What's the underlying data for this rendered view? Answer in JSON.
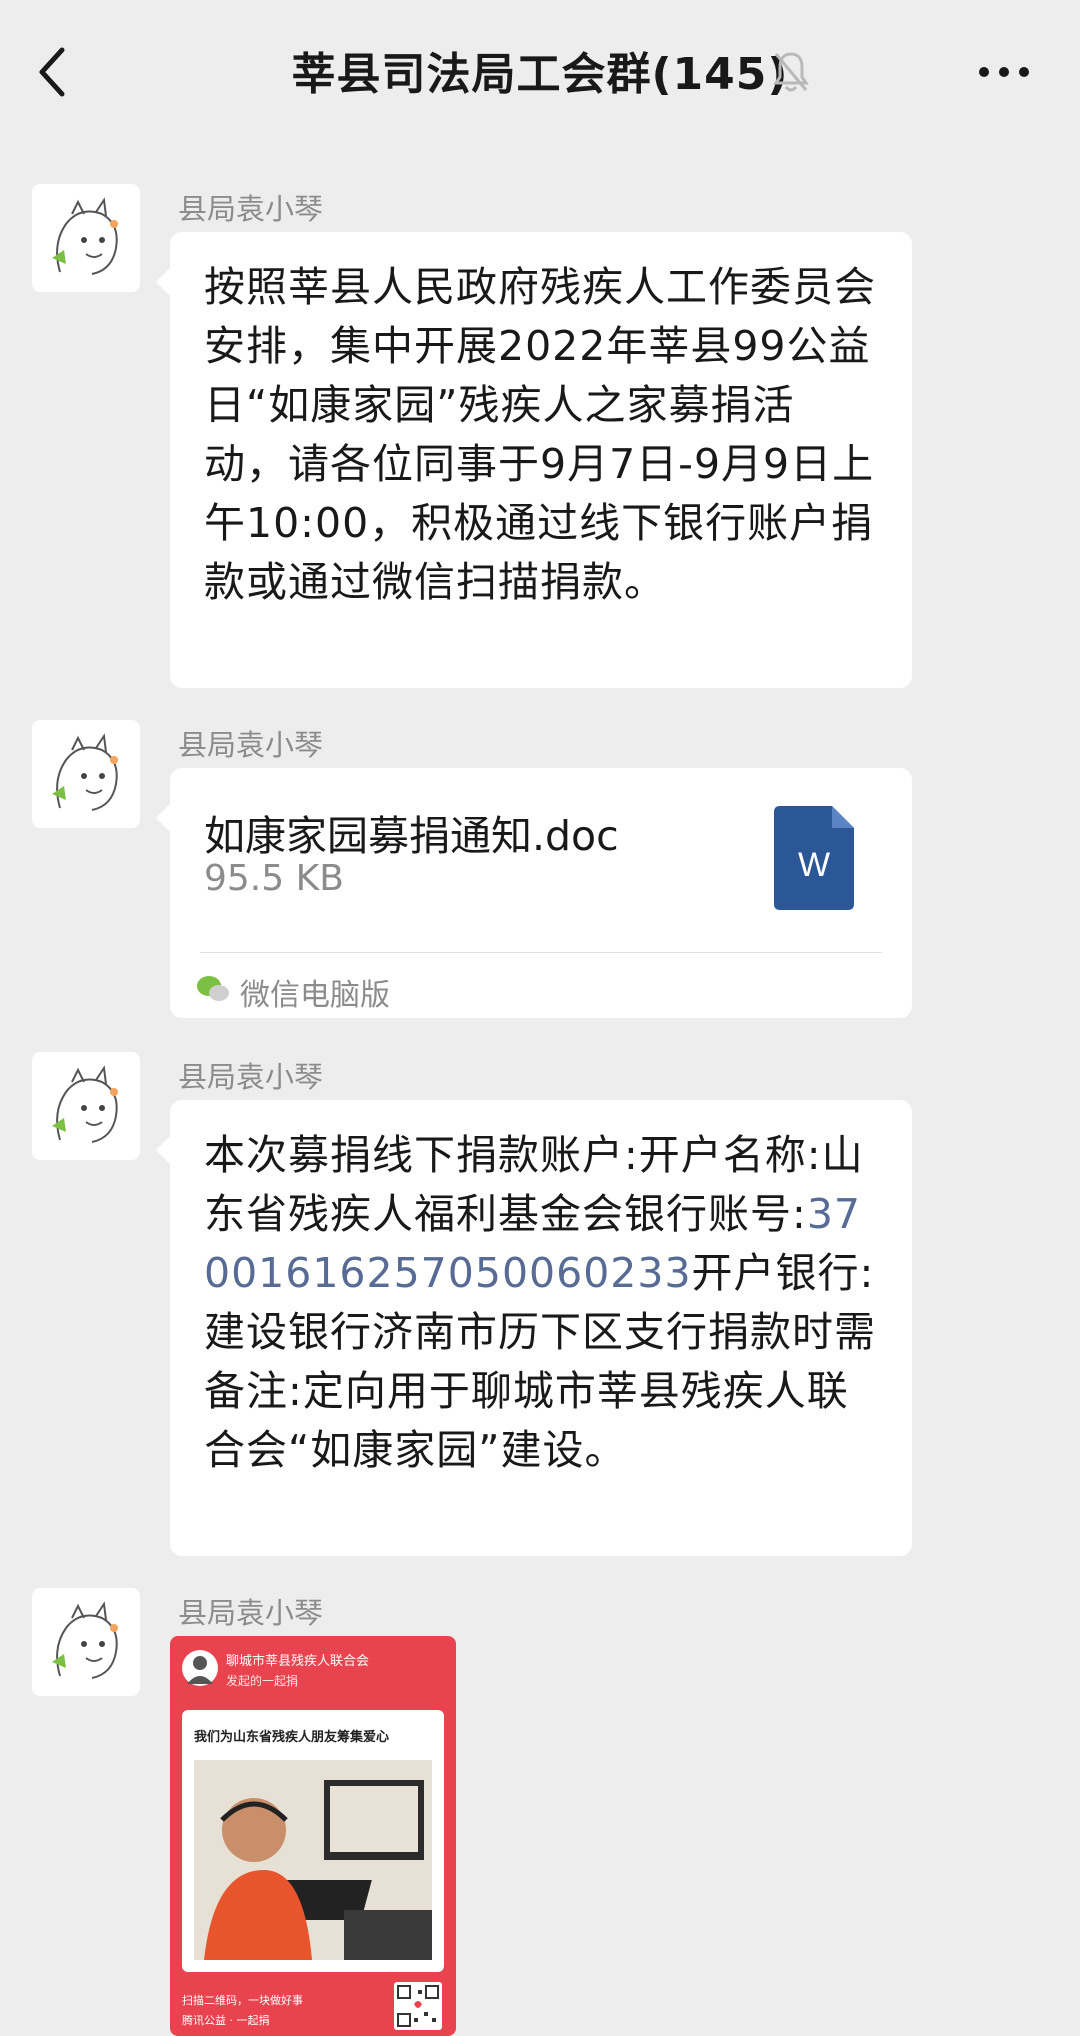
{
  "header": {
    "title": "莘县司法局工会群(145)",
    "back_icon": "chevron-left-icon",
    "mute_icon": "bell-off-icon",
    "more_icon": "more-dots-icon"
  },
  "messages": [
    {
      "sender": "县局袁小琴",
      "type": "text",
      "text": "按照莘县人民政府残疾人工作委员会安排，集中开展2022年莘县99公益日“如康家园”残疾人之家募捐活动，请各位同事于9月7日-9月9日上午10:00，积极通过线下银行账户捐款或通过微信扫描捐款。"
    },
    {
      "sender": "县局袁小琴",
      "type": "file",
      "file_name": "如康家园募捐通知.doc",
      "file_size": "95.5 KB",
      "file_icon_label": "W",
      "source": "微信电脑版"
    },
    {
      "sender": "县局袁小琴",
      "type": "text",
      "text_before": "本次募捐线下捐款账户:开户名称:山东省残疾人福利基金会银行账号:",
      "account": "37001616257050060233",
      "text_after": "开户银行:建设银行济南市历下区支行捐款时需备注:定向用于聊城市莘县残疾人联合会“如康家园”建设。"
    },
    {
      "sender": "县局袁小琴",
      "type": "image",
      "poster": {
        "org": "聊城市莘县残疾人联合会",
        "subtitle": "发起的一起捐",
        "slogan": "我们为山东省残疾人朋友筹集爱心",
        "footer1": "扫描二维码，一块做好事",
        "footer2": "腾讯公益 · 一起捐"
      }
    }
  ],
  "colors": {
    "background": "#ededed",
    "bubble": "#ffffff",
    "link": "#576b95",
    "word_icon": "#2b5797",
    "poster": "#e8434e"
  }
}
